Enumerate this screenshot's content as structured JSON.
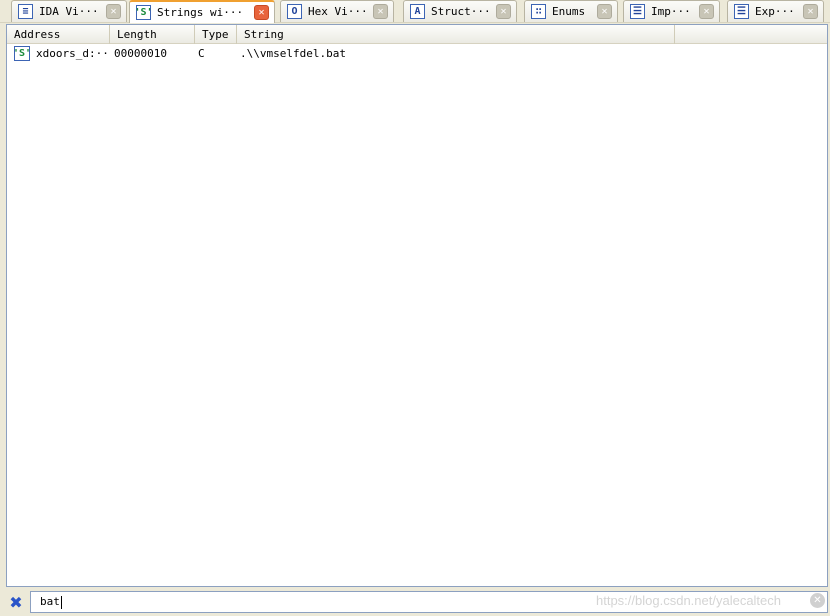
{
  "tabs": [
    {
      "label": "IDA Vi···",
      "icon": "ida-view-icon",
      "glyph": "≡",
      "active": false
    },
    {
      "label": "Strings wi···",
      "icon": "strings-icon",
      "glyph": "'S'",
      "active": true
    },
    {
      "label": "Hex Vi···",
      "icon": "hex-view-icon",
      "glyph": "O",
      "active": false
    },
    {
      "label": "Struct···",
      "icon": "structures-icon",
      "glyph": "A",
      "active": false
    },
    {
      "label": "Enums",
      "icon": "enums-icon",
      "glyph": "∷",
      "active": false
    },
    {
      "label": "Imp···",
      "icon": "imports-icon",
      "glyph": "☰",
      "active": false
    },
    {
      "label": "Exp···",
      "icon": "exports-icon",
      "glyph": "☰",
      "active": false
    }
  ],
  "close_glyph": "✕",
  "columns": [
    "Address",
    "Length",
    "Type",
    "String"
  ],
  "rows": [
    {
      "icon": "string-item-icon",
      "glyph": "'S'",
      "address": "xdoors_d:···",
      "length": "00000010",
      "type": "C",
      "string": ".\\\\vmselfdel.bat"
    }
  ],
  "filter": {
    "icon": "filter-icon",
    "glyph": "✖",
    "value": "bat",
    "clear_icon": "clear-filter-icon",
    "clear_glyph": "✕"
  },
  "watermark": "https://blog.csdn.net/yalecaltech",
  "colors": {
    "active_tab_accent": "#f0a030",
    "active_close": "#e8643c",
    "inactive_close": "#c8c5b6",
    "window_bg": "#ece9d8",
    "border": "#8ca0c0"
  }
}
